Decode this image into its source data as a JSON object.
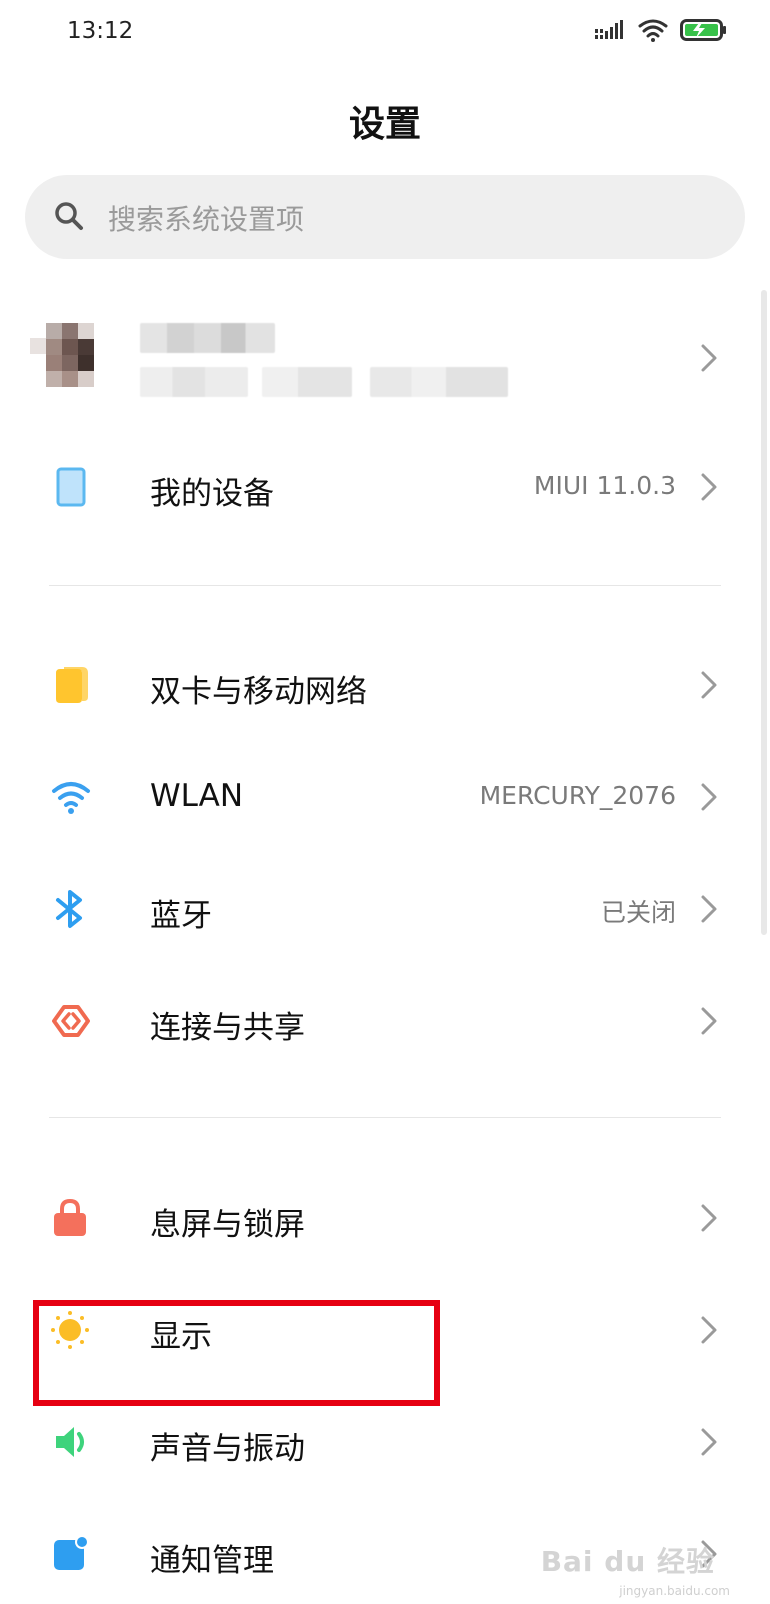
{
  "status_bar": {
    "time": "13:12",
    "icons": [
      "signal-icon",
      "wifi-icon",
      "battery-charging-icon"
    ]
  },
  "header": {
    "title": "设置"
  },
  "search": {
    "placeholder": "搜索系统设置项"
  },
  "profile": {
    "name": "",
    "detail": ""
  },
  "groups": [
    {
      "items": [
        {
          "label": "我的设备",
          "value": "MIUI 11.0.3",
          "icon": "device-icon",
          "color": "#5bb8f0"
        }
      ]
    },
    {
      "items": [
        {
          "label": "双卡与移动网络",
          "value": "",
          "icon": "sim-card-icon",
          "color": "#ffc52e"
        },
        {
          "label": "WLAN",
          "value": "MERCURY_2076",
          "icon": "wifi-icon",
          "color": "#3aa0ef"
        },
        {
          "label": "蓝牙",
          "value": "已关闭",
          "icon": "bluetooth-icon",
          "color": "#2e9ef0"
        },
        {
          "label": "连接与共享",
          "value": "",
          "icon": "connection-share-icon",
          "color": "#f06a50"
        }
      ]
    },
    {
      "items": [
        {
          "label": "息屏与锁屏",
          "value": "",
          "icon": "lock-icon",
          "color": "#f4705c"
        },
        {
          "label": "显示",
          "value": "",
          "icon": "display-brightness-icon",
          "color": "#fbbd26"
        },
        {
          "label": "声音与振动",
          "value": "",
          "icon": "sound-icon",
          "color": "#3ed37c"
        },
        {
          "label": "通知管理",
          "value": "",
          "icon": "notification-icon",
          "color": "#2e9ef0"
        }
      ]
    }
  ],
  "watermark": {
    "text": "Bai du 经验",
    "sub": "jingyan.baidu.com"
  }
}
